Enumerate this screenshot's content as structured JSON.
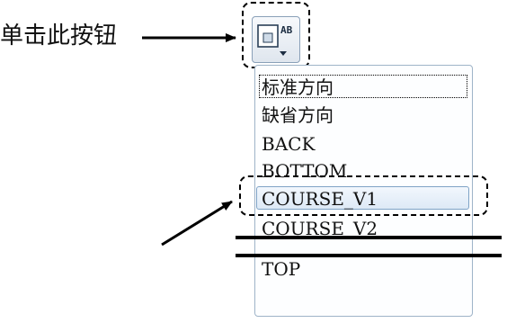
{
  "instruction": "单击此按钮",
  "toolbar": {
    "view_button_glyph": "AB",
    "view_button_icon": "view-orientation-icon"
  },
  "dropdown": {
    "items": [
      {
        "label": "标准方向",
        "state": "focused"
      },
      {
        "label": "缺省方向",
        "state": "normal"
      },
      {
        "label": "BACK",
        "state": "normal"
      },
      {
        "label": "BOTTOM",
        "state": "normal"
      },
      {
        "label": "COURSE_V1",
        "state": "selected"
      },
      {
        "label": "COURSE_V2",
        "state": "normal"
      },
      {
        "label": "TOP",
        "state": "normal"
      }
    ]
  },
  "colors": {
    "annotation": "#000000",
    "dropdown_border": "#9fb4c8",
    "selected_fill": "#dde9f6",
    "selected_border": "#7fa3c6"
  }
}
